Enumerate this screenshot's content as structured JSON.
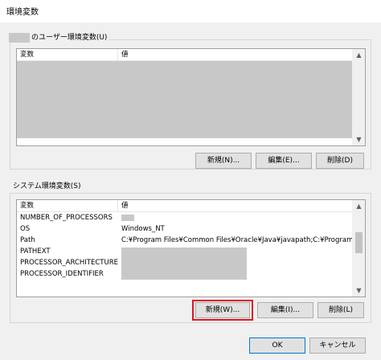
{
  "window": {
    "title": "環境変数"
  },
  "user_vars": {
    "label_suffix": "のユーザー環境変数(U)",
    "columns": {
      "variable": "変数",
      "value": "値"
    },
    "buttons": {
      "new": "新規(N)...",
      "edit": "編集(E)...",
      "delete": "削除(D)"
    }
  },
  "system_vars": {
    "label": "システム環境変数(S)",
    "columns": {
      "variable": "変数",
      "value": "値"
    },
    "rows": [
      {
        "name": "NUMBER_OF_PROCESSORS",
        "value": ""
      },
      {
        "name": "OS",
        "value": "Windows_NT"
      },
      {
        "name": "Path",
        "value": "C:¥Program Files¥Common Files¥Oracle¥Java¥javapath;C:¥Program ..."
      },
      {
        "name": "PATHEXT",
        "value": ""
      },
      {
        "name": "PROCESSOR_ARCHITECTURE",
        "value": ""
      },
      {
        "name": "PROCESSOR_IDENTIFIER",
        "value": ""
      }
    ],
    "buttons": {
      "new": "新規(W)...",
      "edit": "編集(I)...",
      "delete": "削除(L)"
    }
  },
  "dialog_buttons": {
    "ok": "OK",
    "cancel": "キャンセル"
  },
  "colors": {
    "highlight": "#e0141e",
    "redaction": "#c8c8c8",
    "default_button_border": "#0078d7"
  }
}
